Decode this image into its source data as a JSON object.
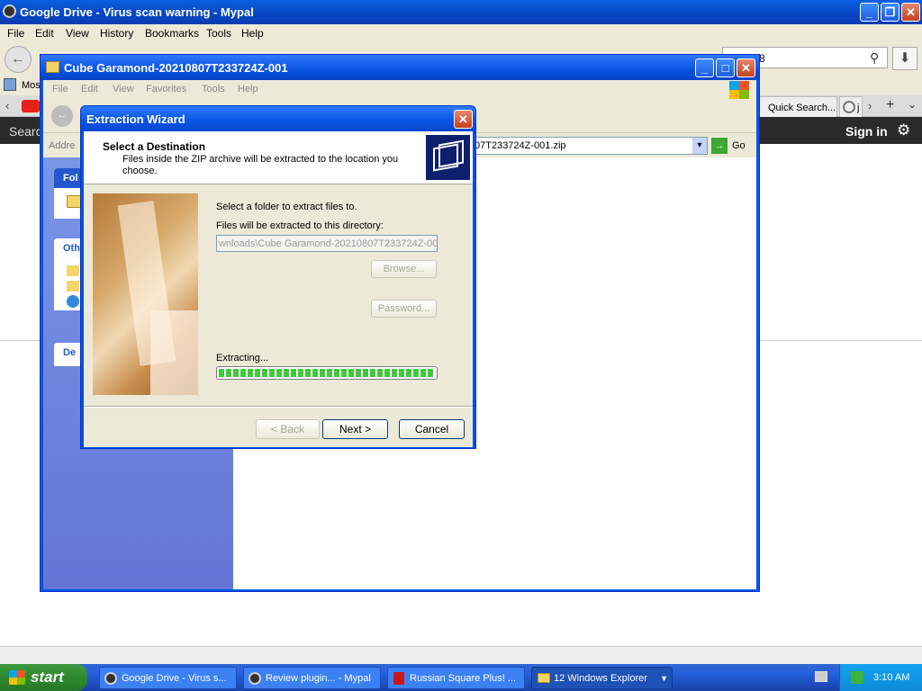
{
  "firefox": {
    "title": "Google Drive - Virus scan warning - Mypal",
    "menu": [
      "File",
      "Edit",
      "View",
      "History",
      "Bookmarks",
      "Tools",
      "Help"
    ],
    "search_value": "8",
    "bookmark_item": "Most",
    "tab_quick": "Quick Search...",
    "tab_other": "j",
    "dark_search": "Searc",
    "sign_in": "Sign in"
  },
  "explorer": {
    "title": "Cube Garamond-20210807T233724Z-001",
    "menu": [
      "File",
      "Edit",
      "View",
      "Favorites",
      "Tools",
      "Help"
    ],
    "address_label": "Addre",
    "address_value": "07T233724Z-001.zip",
    "go_label": "Go",
    "panels": [
      "Fol",
      "Oth",
      "De"
    ]
  },
  "wizard": {
    "title": "Extraction Wizard",
    "heading": "Select a Destination",
    "subheading": "Files inside the ZIP archive will be extracted to the location you choose.",
    "select_text": "Select a folder to extract files to.",
    "dir_text": "Files will be extracted to this directory:",
    "path_value": "wnloads\\Cube Garamond-20210807T233724Z-001",
    "browse_label": "Browse...",
    "password_label": "Password...",
    "extracting_label": "Extracting...",
    "progress_percent": 100,
    "back_label": "< Back",
    "next_label": "Next >",
    "cancel_label": "Cancel"
  },
  "taskbar": {
    "start_label": "start",
    "tasks": [
      {
        "label": "Google Drive - Virus s..."
      },
      {
        "label": "Review plugin... - Mypal"
      },
      {
        "label": "Russian Square Plus! ..."
      },
      {
        "label": "12 Windows Explorer"
      }
    ],
    "clock": "3:10 AM"
  },
  "colors": {
    "accent": "#0a56e0",
    "progress": "#41c93b",
    "start": "#2f8a2f"
  }
}
